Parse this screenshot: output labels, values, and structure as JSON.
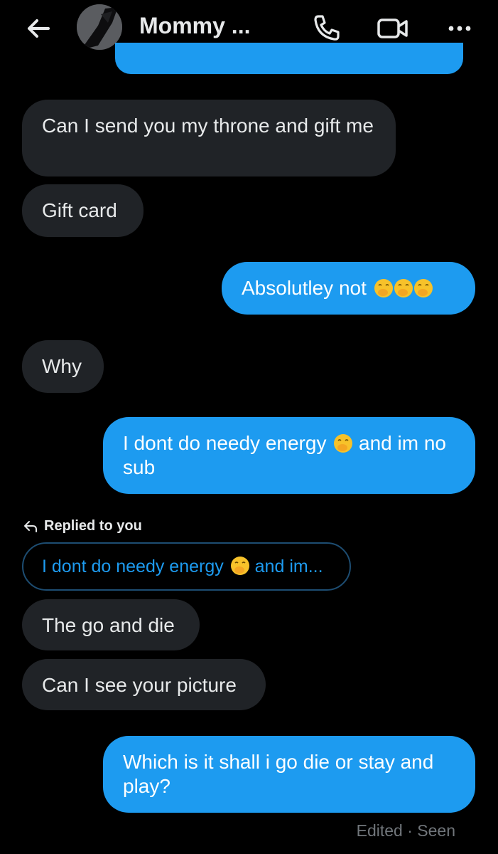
{
  "header": {
    "contact_name": "Mommy ...",
    "icons": [
      "back-arrow-icon",
      "avatar",
      "phone-icon",
      "video-camera-icon",
      "more-dots-icon"
    ]
  },
  "messages": [
    {
      "direction": "incoming",
      "text": "Can I send you my throne and gift me"
    },
    {
      "direction": "incoming",
      "text": "Gift card"
    },
    {
      "direction": "outgoing",
      "text": "Absolutley not"
    },
    {
      "direction": "incoming",
      "text": "Why"
    },
    {
      "direction": "outgoing",
      "text_before": "I dont do needy energy",
      "text_after": "and im no sub"
    },
    {
      "direction": "incoming",
      "reply_label": "Replied to you",
      "quoted_before": "I dont do needy energy",
      "quoted_after": "and im...",
      "text": "The go and die"
    },
    {
      "direction": "incoming",
      "text": "Can I see your picture"
    },
    {
      "direction": "outgoing",
      "text": "Which is it shall i go die or stay and play?"
    }
  ],
  "status": "Edited · Seen",
  "colors": {
    "outgoing_bubble": "#1d9bf0",
    "incoming_bubble": "#202327",
    "background": "#000000"
  }
}
